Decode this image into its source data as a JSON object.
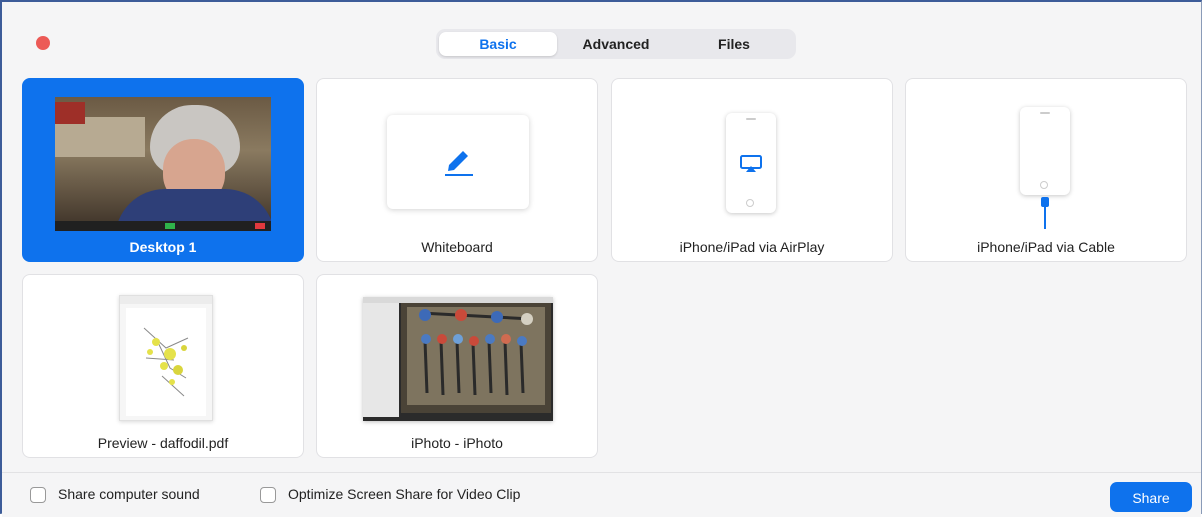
{
  "tabs": [
    {
      "label": "Basic",
      "active": true
    },
    {
      "label": "Advanced",
      "active": false
    },
    {
      "label": "Files",
      "active": false
    }
  ],
  "cards": {
    "desktop1": "Desktop 1",
    "whiteboard": "Whiteboard",
    "airplay": "iPhone/iPad via AirPlay",
    "cable": "iPhone/iPad via Cable",
    "preview": "Preview - daffodil.pdf",
    "iphoto": "iPhoto - iPhoto"
  },
  "options": {
    "share_sound": "Share computer sound",
    "optimize_video": "Optimize Screen Share for Video Clip"
  },
  "share_button": "Share",
  "colors": {
    "accent": "#0e72ed",
    "close": "#ec5a56"
  },
  "icons": {
    "whiteboard": "pencil-icon",
    "airplay": "airplay-icon",
    "cable": "cable-icon"
  }
}
